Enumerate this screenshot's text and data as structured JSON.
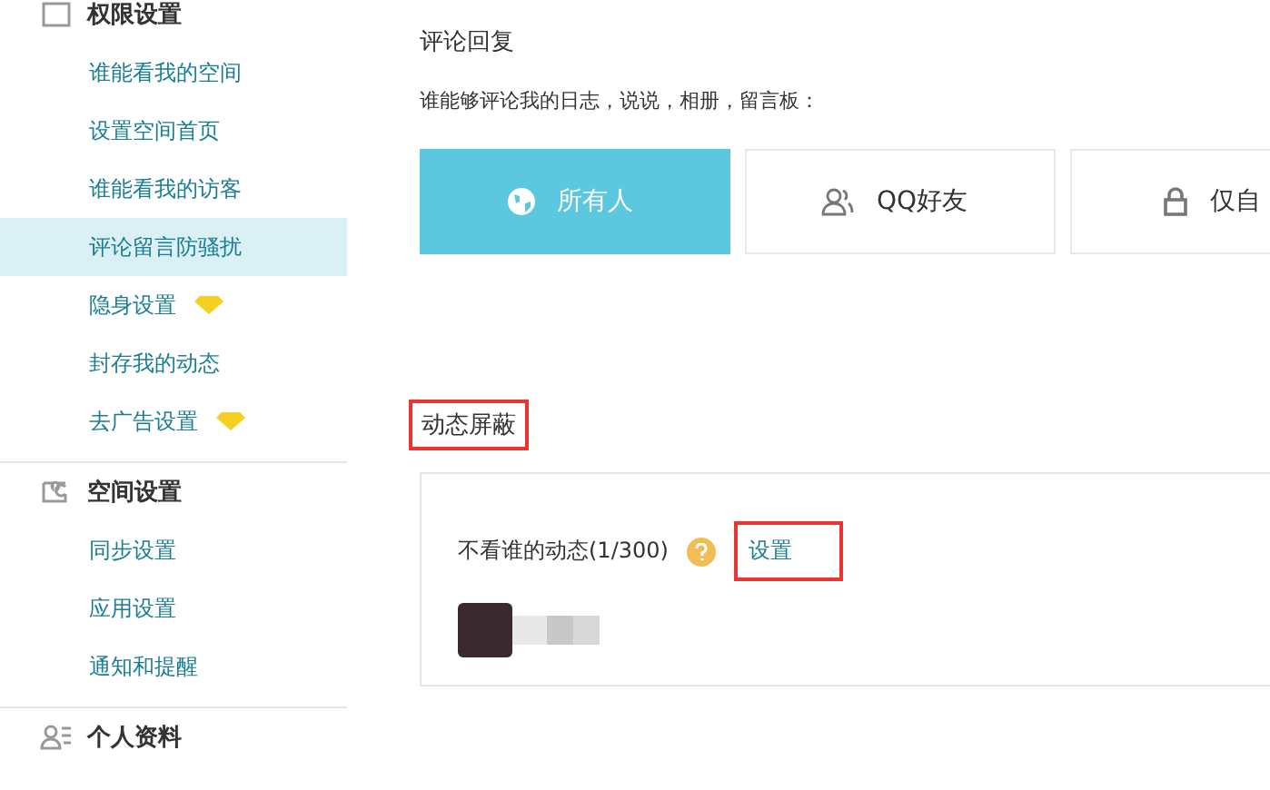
{
  "sidebar": {
    "sections": [
      {
        "title": "权限设置",
        "items": [
          {
            "label": "谁能看我的空间",
            "selected": false,
            "premium": false
          },
          {
            "label": "设置空间首页",
            "selected": false,
            "premium": false
          },
          {
            "label": "谁能看我的访客",
            "selected": false,
            "premium": false
          },
          {
            "label": "评论留言防骚扰",
            "selected": true,
            "premium": false
          },
          {
            "label": "隐身设置",
            "selected": false,
            "premium": true
          },
          {
            "label": "封存我的动态",
            "selected": false,
            "premium": false
          },
          {
            "label": "去广告设置",
            "selected": false,
            "premium": true
          }
        ]
      },
      {
        "title": "空间设置",
        "items": [
          {
            "label": "同步设置",
            "selected": false,
            "premium": false
          },
          {
            "label": "应用设置",
            "selected": false,
            "premium": false
          },
          {
            "label": "通知和提醒",
            "selected": false,
            "premium": false
          }
        ]
      },
      {
        "title": "个人资料"
      }
    ]
  },
  "comment_reply": {
    "title": "评论回复",
    "question": "谁能够评论我的日志，说说，相册，留言板：",
    "options": [
      {
        "label": "所有人",
        "selected": true
      },
      {
        "label": "QQ好友",
        "selected": false
      },
      {
        "label": "仅自",
        "selected": false
      }
    ]
  },
  "feed_block": {
    "title": "动态屏蔽",
    "title_highlighted": true,
    "label": "不看谁的动态(1/300)",
    "link": "设置",
    "link_highlighted": true
  }
}
